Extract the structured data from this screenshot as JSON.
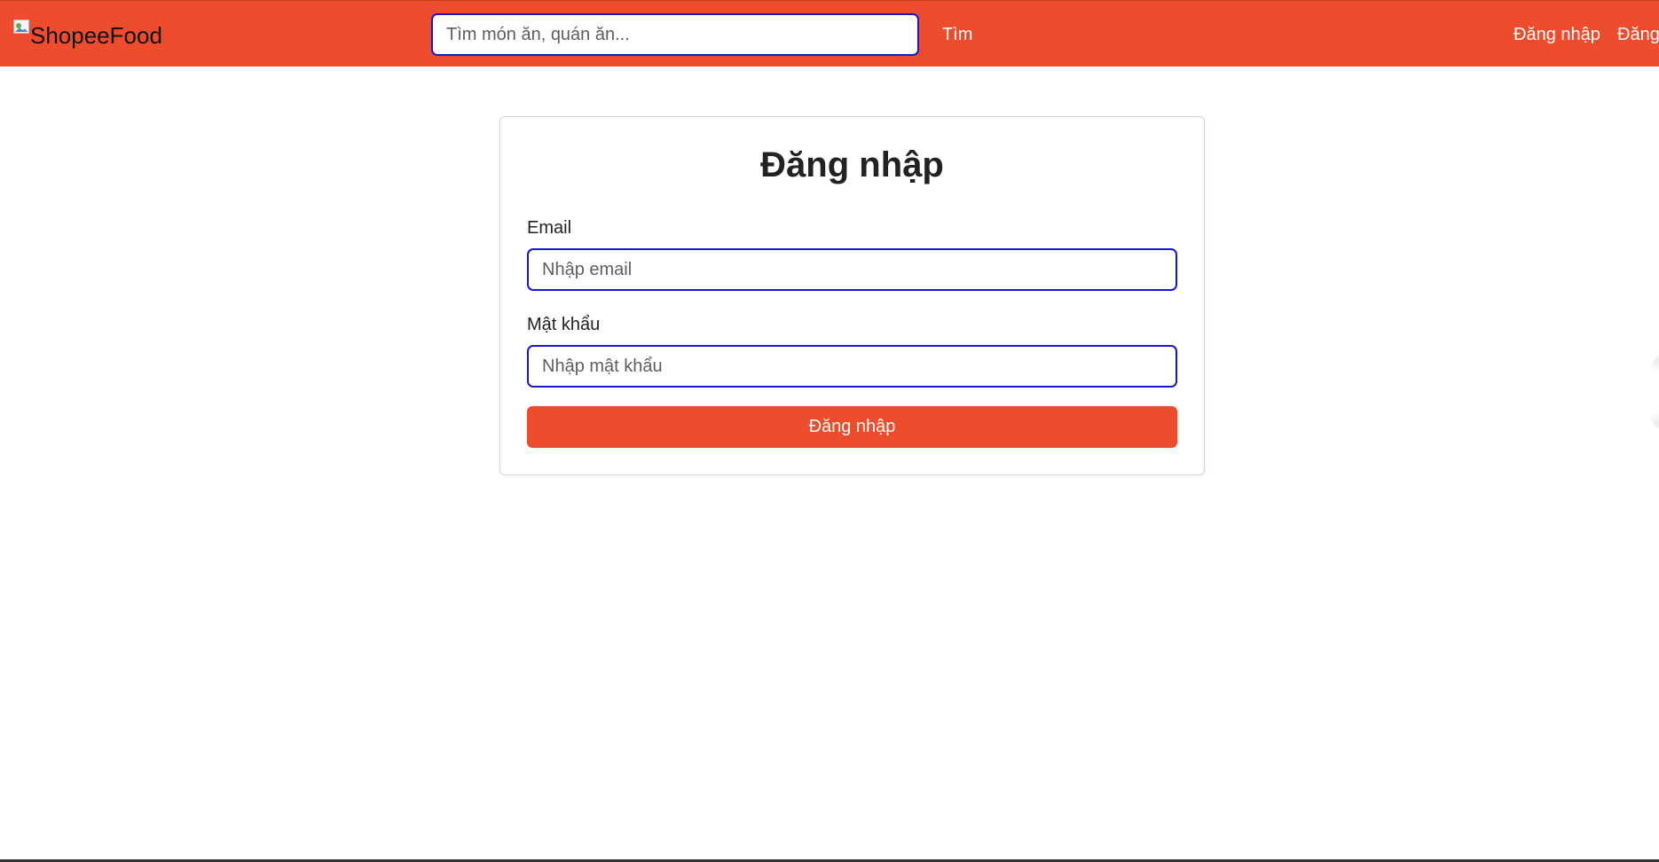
{
  "header": {
    "logo_alt": "ShopeeFood",
    "search_placeholder": "Tìm món ăn, quán ăn...",
    "search_button_label": "Tìm",
    "nav_login_label": "Đăng nhập",
    "nav_register_label": "Đăng"
  },
  "login_form": {
    "title": "Đăng nhập",
    "email_label": "Email",
    "email_placeholder": "Nhập email",
    "password_label": "Mật khẩu",
    "password_placeholder": "Nhập mật khẩu",
    "submit_label": "Đăng nhập"
  },
  "colors": {
    "brand": "#ee4d2d",
    "focus_border": "#1a16cc",
    "text": "#222222"
  },
  "icons": {
    "logo": "broken-image-icon"
  }
}
